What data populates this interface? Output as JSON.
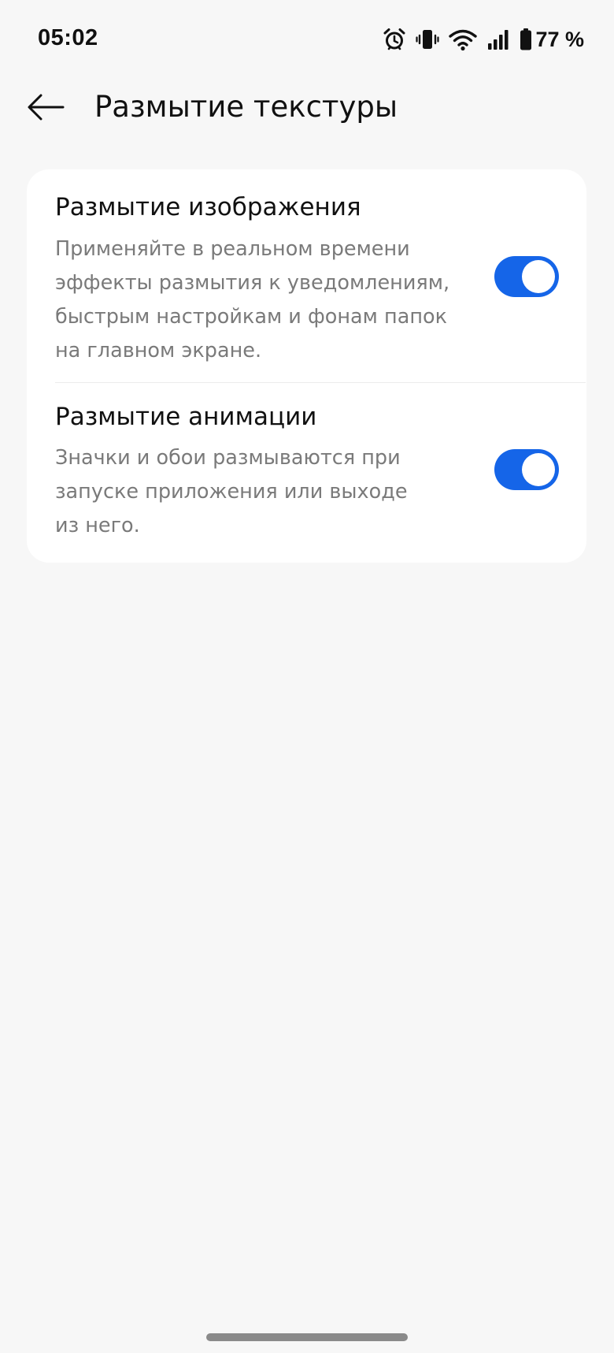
{
  "status_bar": {
    "time": "05:02",
    "battery": "77 %",
    "icons": [
      "alarm-icon",
      "vibrate-icon",
      "wifi-icon",
      "signal-icon",
      "battery-icon"
    ]
  },
  "app_bar": {
    "title": "Размытие текстуры",
    "back_icon": "arrow-left-icon"
  },
  "settings": [
    {
      "title": "Размытие изображения",
      "description_lines": [
        "Применяйте в реальном времени",
        "эффекты размытия к уведомлениям,",
        "быстрым настройкам и фонам папок",
        "на главном экране."
      ],
      "enabled": true
    },
    {
      "title": "Размытие анимации",
      "description_lines": [
        "Значки и обои размываются при",
        "запуске приложения или выходе",
        "из него."
      ],
      "enabled": true
    }
  ],
  "colors": {
    "background": "#f7f7f7",
    "card": "#ffffff",
    "accent": "#1565e8",
    "secondary_text": "#7a7a7a"
  }
}
